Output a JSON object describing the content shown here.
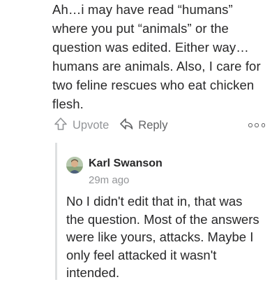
{
  "parent_comment": {
    "lines": [
      "Ah…i may have read “humans”",
      "where you put “animals” or the",
      "question was edited. Either way…",
      "humans are animals. Also, I care for",
      "two feline rescues who eat chicken",
      "flesh."
    ],
    "actions": {
      "upvote_label": "Upvote",
      "reply_label": "Reply",
      "upvote_icon": "upvote-arrow-icon",
      "reply_icon": "reply-arrow-icon",
      "more_icon": "more-options-icon"
    }
  },
  "reply_comment": {
    "author": "Karl Swanson",
    "timestamp": "29m ago",
    "lines": [
      "No I didn't edit that in, that was",
      "the question. Most of the answers",
      "were like yours, attacks. Maybe I",
      "only feel attacked it wasn't",
      "intended."
    ]
  },
  "colors": {
    "text": "#282829",
    "muted": "#939598",
    "secondary": "#636466",
    "thread_line": "#dee0e1"
  }
}
